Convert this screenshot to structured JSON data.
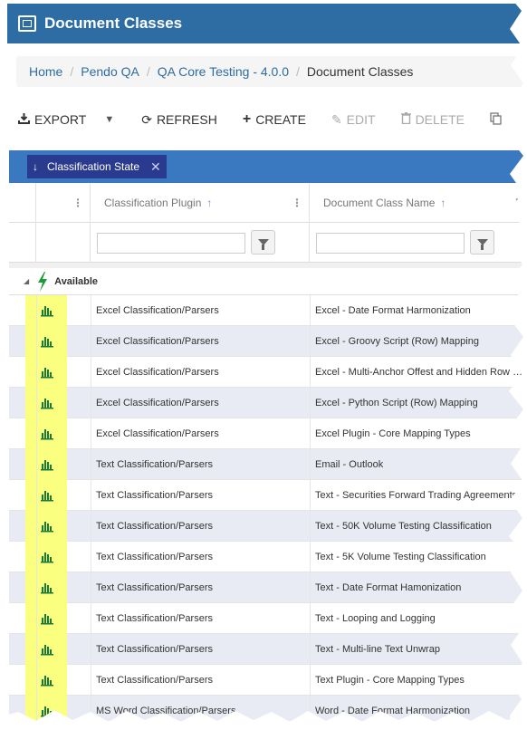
{
  "window": {
    "title": "Document Classes",
    "icon": "window-icon"
  },
  "breadcrumb": {
    "items": [
      "Home",
      "Pendo QA",
      "QA Core Testing - 4.0.0"
    ],
    "current": "Document Classes"
  },
  "toolbar": {
    "export_label": "EXPORT",
    "refresh_label": "REFRESH",
    "create_label": "CREATE",
    "edit_label": "EDIT",
    "delete_label": "DELETE"
  },
  "grouping": {
    "chip_label": "Classification State"
  },
  "columns": {
    "plugin": "Classification Plugin",
    "name": "Document Class Name"
  },
  "group": {
    "label": "Available"
  },
  "rows": [
    {
      "plugin": "Excel Classification/Parsers",
      "name": "Excel - Date Format Harmonization"
    },
    {
      "plugin": "Excel Classification/Parsers",
      "name": "Excel - Groovy Script (Row) Mapping"
    },
    {
      "plugin": "Excel Classification/Parsers",
      "name": "Excel - Multi-Anchor Offest and Hidden Row Detection"
    },
    {
      "plugin": "Excel Classification/Parsers",
      "name": "Excel - Python Script (Row) Mapping"
    },
    {
      "plugin": "Excel Classification/Parsers",
      "name": "Excel Plugin - Core Mapping Types"
    },
    {
      "plugin": "Text Classification/Parsers",
      "name": "Email - Outlook"
    },
    {
      "plugin": "Text Classification/Parsers",
      "name": "Text - Securities Forward Trading Agreements"
    },
    {
      "plugin": "Text Classification/Parsers",
      "name": "Text - 50K Volume Testing Classification"
    },
    {
      "plugin": "Text Classification/Parsers",
      "name": "Text - 5K Volume Testing Classification"
    },
    {
      "plugin": "Text Classification/Parsers",
      "name": "Text - Date Format Hamonization"
    },
    {
      "plugin": "Text Classification/Parsers",
      "name": "Text - Looping and Logging"
    },
    {
      "plugin": "Text Classification/Parsers",
      "name": "Text - Multi-line Text Unwrap"
    },
    {
      "plugin": "Text Classification/Parsers",
      "name": "Text Plugin - Core Mapping Types"
    },
    {
      "plugin": "MS Word Classification/Parsers",
      "name": "Word - Date Format Harmonization"
    }
  ],
  "colors": {
    "header": "#2e6ca4",
    "group_bar": "#3a78c0",
    "chip": "#2a3b8f",
    "highlight": "#fbff80",
    "bolt": "#1f9a3a"
  }
}
